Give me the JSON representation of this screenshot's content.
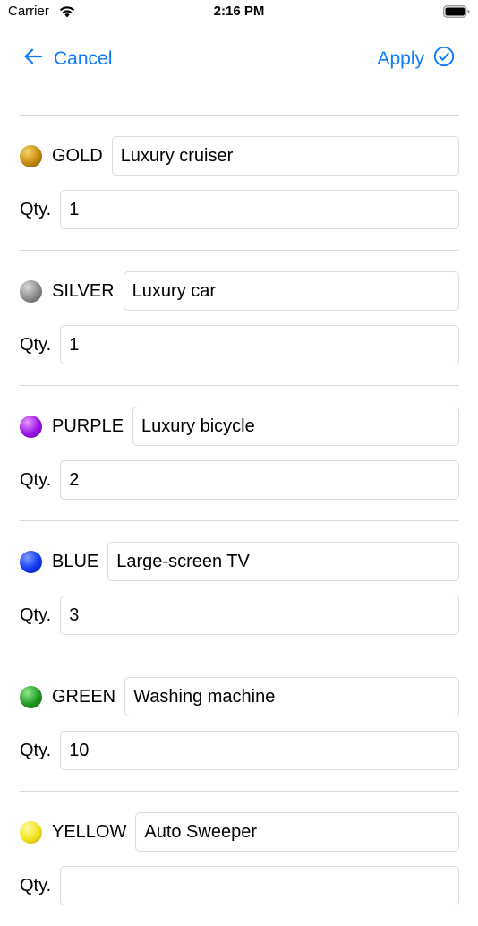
{
  "status_bar": {
    "carrier": "Carrier",
    "time": "2:16 PM"
  },
  "nav": {
    "cancel_label": "Cancel",
    "apply_label": "Apply"
  },
  "accent_color": "#0a7aff",
  "qty_label": "Qty.",
  "prizes": [
    {
      "color_name": "GOLD",
      "ball": [
        "#f6d46a",
        "#c58a10",
        "#7a4e00"
      ],
      "prize": "Luxury cruiser",
      "qty": "1"
    },
    {
      "color_name": "SILVER",
      "ball": [
        "#d9d9d9",
        "#8a8a8a",
        "#4f4f4f"
      ],
      "prize": "Luxury car",
      "qty": "1"
    },
    {
      "color_name": "PURPLE",
      "ball": [
        "#e59bff",
        "#9c10e6",
        "#5e0096"
      ],
      "prize": "Luxury bicycle",
      "qty": "2"
    },
    {
      "color_name": "BLUE",
      "ball": [
        "#7f9dff",
        "#1037f0",
        "#061c9a"
      ],
      "prize": "Large-screen TV",
      "qty": "3"
    },
    {
      "color_name": "GREEN",
      "ball": [
        "#8fe88f",
        "#1f9a1f",
        "#0a5a0a"
      ],
      "prize": "Washing machine",
      "qty": "10"
    },
    {
      "color_name": "YELLOW",
      "ball": [
        "#fffaa0",
        "#f2e21b",
        "#b5a500"
      ],
      "prize": "Auto Sweeper",
      "qty": ""
    }
  ]
}
